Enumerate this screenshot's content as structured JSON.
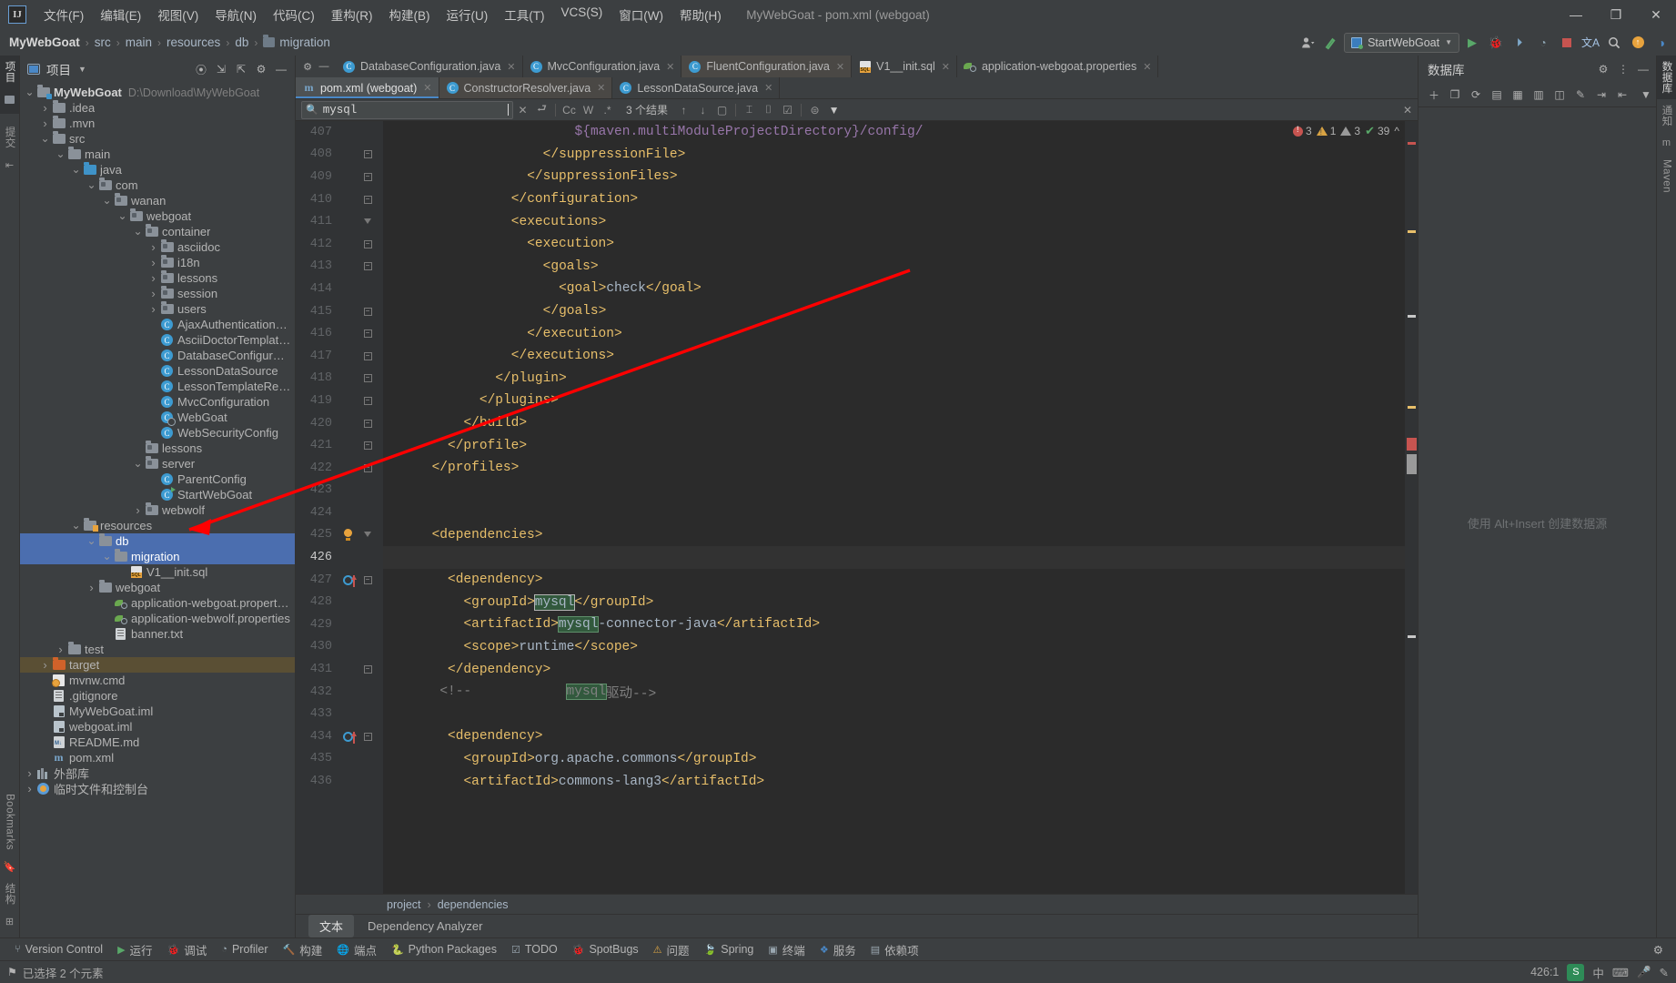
{
  "window": {
    "title": "MyWebGoat - pom.xml (webgoat)",
    "minimize": "—",
    "maximize": "❐",
    "close": "✕"
  },
  "menubar": {
    "logo": "IJ",
    "items": [
      {
        "label": "文件(F)"
      },
      {
        "label": "编辑(E)"
      },
      {
        "label": "视图(V)"
      },
      {
        "label": "导航(N)"
      },
      {
        "label": "代码(C)"
      },
      {
        "label": "重构(R)"
      },
      {
        "label": "构建(B)"
      },
      {
        "label": "运行(U)"
      },
      {
        "label": "工具(T)"
      },
      {
        "label": "VCS(S)"
      },
      {
        "label": "窗口(W)"
      },
      {
        "label": "帮助(H)"
      }
    ]
  },
  "navbar": {
    "crumbs": [
      "MyWebGoat",
      "src",
      "main",
      "resources",
      "db",
      "migration"
    ],
    "run_config": "StartWebGoat",
    "separator": "›"
  },
  "left_strip": {
    "project_label": "项目",
    "commit_label": "提交",
    "structure_label": "结构",
    "bookmarks_label": "Bookmarks"
  },
  "right_strip": {
    "database_label": "数据库",
    "notifications_label": "通知",
    "maven_label": "Maven"
  },
  "project_panel": {
    "title": "项目",
    "tree": [
      {
        "depth": 0,
        "arrow": "v",
        "icon": "module-folder",
        "label": "MyWebGoat",
        "sub": "D:\\Download\\MyWebGoat",
        "bold": true
      },
      {
        "depth": 1,
        "arrow": ">",
        "icon": "folder",
        "label": ".idea"
      },
      {
        "depth": 1,
        "arrow": ">",
        "icon": "folder",
        "label": ".mvn"
      },
      {
        "depth": 1,
        "arrow": "v",
        "icon": "folder",
        "label": "src"
      },
      {
        "depth": 2,
        "arrow": "v",
        "icon": "folder",
        "label": "main"
      },
      {
        "depth": 3,
        "arrow": "v",
        "icon": "source-folder",
        "label": "java"
      },
      {
        "depth": 4,
        "arrow": "v",
        "icon": "package",
        "label": "com"
      },
      {
        "depth": 5,
        "arrow": "v",
        "icon": "package",
        "label": "wanan"
      },
      {
        "depth": 6,
        "arrow": "v",
        "icon": "package",
        "label": "webgoat"
      },
      {
        "depth": 7,
        "arrow": "v",
        "icon": "package",
        "label": "container"
      },
      {
        "depth": 8,
        "arrow": ">",
        "icon": "package",
        "label": "asciidoc"
      },
      {
        "depth": 8,
        "arrow": ">",
        "icon": "package",
        "label": "i18n"
      },
      {
        "depth": 8,
        "arrow": ">",
        "icon": "package",
        "label": "lessons"
      },
      {
        "depth": 8,
        "arrow": ">",
        "icon": "package",
        "label": "session"
      },
      {
        "depth": 8,
        "arrow": ">",
        "icon": "package",
        "label": "users"
      },
      {
        "depth": 8,
        "arrow": "",
        "icon": "class",
        "label": "AjaxAuthenticationEntryPoint"
      },
      {
        "depth": 8,
        "arrow": "",
        "icon": "class",
        "label": "AsciiDoctorTemplateResolver"
      },
      {
        "depth": 8,
        "arrow": "",
        "icon": "class",
        "label": "DatabaseConfiguration"
      },
      {
        "depth": 8,
        "arrow": "",
        "icon": "class",
        "label": "LessonDataSource"
      },
      {
        "depth": 8,
        "arrow": "",
        "icon": "class",
        "label": "LessonTemplateResolver"
      },
      {
        "depth": 8,
        "arrow": "",
        "icon": "class",
        "label": "MvcConfiguration"
      },
      {
        "depth": 8,
        "arrow": "",
        "icon": "class-gear",
        "label": "WebGoat"
      },
      {
        "depth": 8,
        "arrow": "",
        "icon": "class",
        "label": "WebSecurityConfig"
      },
      {
        "depth": 7,
        "arrow": "",
        "icon": "package",
        "label": "lessons"
      },
      {
        "depth": 7,
        "arrow": "v",
        "icon": "package",
        "label": "server"
      },
      {
        "depth": 8,
        "arrow": "",
        "icon": "class",
        "label": "ParentConfig"
      },
      {
        "depth": 8,
        "arrow": "",
        "icon": "class-run",
        "label": "StartWebGoat"
      },
      {
        "depth": 7,
        "arrow": ">",
        "icon": "package",
        "label": "webwolf"
      },
      {
        "depth": 3,
        "arrow": "v",
        "icon": "resource-folder",
        "label": "resources"
      },
      {
        "depth": 4,
        "arrow": "v",
        "icon": "folder",
        "label": "db",
        "selected": true
      },
      {
        "depth": 5,
        "arrow": "v",
        "icon": "folder",
        "label": "migration",
        "selected": true
      },
      {
        "depth": 6,
        "arrow": "",
        "icon": "sql",
        "label": "V1__init.sql"
      },
      {
        "depth": 4,
        "arrow": ">",
        "icon": "folder",
        "label": "webgoat"
      },
      {
        "depth": 5,
        "arrow": "",
        "icon": "properties",
        "label": "application-webgoat.properties"
      },
      {
        "depth": 5,
        "arrow": "",
        "icon": "properties",
        "label": "application-webwolf.properties"
      },
      {
        "depth": 5,
        "arrow": "",
        "icon": "text",
        "label": "banner.txt"
      },
      {
        "depth": 2,
        "arrow": ">",
        "icon": "folder",
        "label": "test"
      },
      {
        "depth": 1,
        "arrow": ">",
        "icon": "folder-excluded",
        "label": "target",
        "highlighted": true
      },
      {
        "depth": 1,
        "arrow": "",
        "icon": "cmd",
        "label": "mvnw.cmd"
      },
      {
        "depth": 1,
        "arrow": "",
        "icon": "gitignore",
        "label": ".gitignore"
      },
      {
        "depth": 1,
        "arrow": "",
        "icon": "iml",
        "label": "MyWebGoat.iml"
      },
      {
        "depth": 1,
        "arrow": "",
        "icon": "iml",
        "label": "webgoat.iml"
      },
      {
        "depth": 1,
        "arrow": "",
        "icon": "markdown",
        "label": "README.md"
      },
      {
        "depth": 1,
        "arrow": "",
        "icon": "maven",
        "label": "pom.xml"
      },
      {
        "depth": 0,
        "arrow": ">",
        "icon": "library",
        "label": "外部库"
      },
      {
        "depth": 0,
        "arrow": ">",
        "icon": "scratch",
        "label": "临时文件和控制台"
      }
    ]
  },
  "editor": {
    "tabs_row1": [
      {
        "label": "DatabaseConfiguration.java",
        "icon": "class",
        "state": "normal"
      },
      {
        "label": "MvcConfiguration.java",
        "icon": "class",
        "state": "normal"
      },
      {
        "label": "FluentConfiguration.java",
        "icon": "class",
        "state": "modified"
      },
      {
        "label": "V1__init.sql",
        "icon": "sql",
        "state": "normal"
      },
      {
        "label": "application-webgoat.properties",
        "icon": "properties",
        "state": "normal"
      }
    ],
    "tabs_row2": [
      {
        "label": "pom.xml (webgoat)",
        "icon": "maven",
        "state": "active"
      },
      {
        "label": "ConstructorResolver.java",
        "icon": "class",
        "state": "modified"
      },
      {
        "label": "LessonDataSource.java",
        "icon": "class",
        "state": "normal"
      }
    ],
    "find": {
      "value": "mysql",
      "results": "3 个结果",
      "match_case": "Cc",
      "words": "W",
      "regex": ".*",
      "close": "✕"
    },
    "inspections": {
      "errors": "3",
      "warnings": "1",
      "weak_warnings": "3",
      "checks": "39"
    },
    "breadcrumbs": [
      "project",
      "dependencies"
    ],
    "bottom_tabs": [
      {
        "label": "文本",
        "active": true
      },
      {
        "label": "Dependency Analyzer",
        "active": false
      }
    ],
    "code_lines": [
      {
        "num": "407",
        "fold": "",
        "indent": 23,
        "tokens": [
          {
            "t": "${maven.multiModuleProjectDirectory}/config/",
            "c": "mvar"
          }
        ]
      },
      {
        "num": "408",
        "fold": "minus",
        "indent": 19,
        "tokens": [
          {
            "t": "</suppressionFile>",
            "c": "tag"
          }
        ]
      },
      {
        "num": "409",
        "fold": "minus",
        "indent": 17,
        "tokens": [
          {
            "t": "</suppressionFiles>",
            "c": "tag"
          }
        ]
      },
      {
        "num": "410",
        "fold": "minus",
        "indent": 15,
        "tokens": [
          {
            "t": "</configuration>",
            "c": "tag"
          }
        ]
      },
      {
        "num": "411",
        "fold": "arrow",
        "indent": 15,
        "tokens": [
          {
            "t": "<executions>",
            "c": "tag"
          }
        ]
      },
      {
        "num": "412",
        "fold": "minus",
        "indent": 17,
        "tokens": [
          {
            "t": "<execution>",
            "c": "tag"
          }
        ]
      },
      {
        "num": "413",
        "fold": "minus",
        "indent": 19,
        "tokens": [
          {
            "t": "<goals>",
            "c": "tag"
          }
        ]
      },
      {
        "num": "414",
        "fold": "",
        "indent": 21,
        "tokens": [
          {
            "t": "<goal>",
            "c": "tag"
          },
          {
            "t": "check",
            "c": "txtv"
          },
          {
            "t": "</goal>",
            "c": "tag"
          }
        ]
      },
      {
        "num": "415",
        "fold": "minus",
        "indent": 19,
        "tokens": [
          {
            "t": "</goals>",
            "c": "tag"
          }
        ]
      },
      {
        "num": "416",
        "fold": "minus",
        "indent": 17,
        "tokens": [
          {
            "t": "</execution>",
            "c": "tag"
          }
        ]
      },
      {
        "num": "417",
        "fold": "minus",
        "indent": 15,
        "tokens": [
          {
            "t": "</executions>",
            "c": "tag"
          }
        ]
      },
      {
        "num": "418",
        "fold": "minus",
        "indent": 13,
        "tokens": [
          {
            "t": "</plugin>",
            "c": "tag"
          }
        ]
      },
      {
        "num": "419",
        "fold": "minus",
        "indent": 11,
        "tokens": [
          {
            "t": "</plugins>",
            "c": "tag"
          }
        ]
      },
      {
        "num": "420",
        "fold": "minus",
        "indent": 9,
        "tokens": [
          {
            "t": "</build>",
            "c": "tag"
          }
        ]
      },
      {
        "num": "421",
        "fold": "minus",
        "indent": 7,
        "tokens": [
          {
            "t": "</profile>",
            "c": "tag"
          }
        ]
      },
      {
        "num": "422",
        "fold": "minus",
        "indent": 5,
        "tokens": [
          {
            "t": "</profiles>",
            "c": "tag"
          }
        ]
      },
      {
        "num": "423",
        "fold": "",
        "indent": 0,
        "tokens": []
      },
      {
        "num": "424",
        "fold": "",
        "indent": 0,
        "tokens": []
      },
      {
        "num": "425",
        "fold": "arrow",
        "ann": "bulb",
        "indent": 5,
        "tokens": [
          {
            "t": "<dependencies>",
            "c": "tag"
          }
        ]
      },
      {
        "num": "426",
        "fold": "",
        "indent": 0,
        "current": true,
        "tokens": []
      },
      {
        "num": "427",
        "fold": "minus",
        "ann": "override",
        "indent": 7,
        "tokens": [
          {
            "t": "<dependency>",
            "c": "tag"
          }
        ]
      },
      {
        "num": "428",
        "fold": "",
        "indent": 9,
        "tokens": [
          {
            "t": "<groupId>",
            "c": "tag"
          },
          {
            "t": "mysql",
            "c": "txtv",
            "hl": "cursor"
          },
          {
            "t": "</groupId>",
            "c": "tag"
          }
        ]
      },
      {
        "num": "429",
        "fold": "",
        "indent": 9,
        "tokens": [
          {
            "t": "<artifactId>",
            "c": "tag"
          },
          {
            "t": "mysql",
            "c": "txtv",
            "hl": "match"
          },
          {
            "t": "-connector-java",
            "c": "txtv"
          },
          {
            "t": "</artifactId>",
            "c": "tag"
          }
        ]
      },
      {
        "num": "430",
        "fold": "",
        "indent": 9,
        "tokens": [
          {
            "t": "<scope>",
            "c": "tag"
          },
          {
            "t": "runtime",
            "c": "txtv"
          },
          {
            "t": "</scope>",
            "c": "tag"
          }
        ]
      },
      {
        "num": "431",
        "fold": "minus",
        "indent": 7,
        "tokens": [
          {
            "t": "</dependency>",
            "c": "tag"
          }
        ]
      },
      {
        "num": "432",
        "fold": "",
        "indent": 6,
        "tokens": [
          {
            "t": "<!--            ",
            "c": "cmt"
          },
          {
            "t": "mysql",
            "c": "cmt",
            "hl": "match"
          },
          {
            "t": "驱动-->",
            "c": "cmt"
          }
        ]
      },
      {
        "num": "433",
        "fold": "",
        "indent": 0,
        "tokens": []
      },
      {
        "num": "434",
        "fold": "minus",
        "ann": "override",
        "indent": 7,
        "tokens": [
          {
            "t": "<dependency>",
            "c": "tag"
          }
        ]
      },
      {
        "num": "435",
        "fold": "",
        "indent": 9,
        "tokens": [
          {
            "t": "<groupId>",
            "c": "tag"
          },
          {
            "t": "org.apache.commons",
            "c": "txtv"
          },
          {
            "t": "</groupId>",
            "c": "tag"
          }
        ]
      },
      {
        "num": "436",
        "fold": "",
        "indent": 9,
        "tokens": [
          {
            "t": "<artifactId>",
            "c": "tag"
          },
          {
            "t": "commons-lang3",
            "c": "txtv"
          },
          {
            "t": "</artifactId>",
            "c": "tag"
          }
        ]
      }
    ]
  },
  "database_panel": {
    "title": "数据库",
    "empty_hint": "使用 Alt+Insert 创建数据源"
  },
  "bottom_toolwindows": [
    {
      "label": "Version Control",
      "icon": "branch"
    },
    {
      "label": "运行",
      "icon": "play"
    },
    {
      "label": "调试",
      "icon": "bug"
    },
    {
      "label": "Profiler",
      "icon": "gauge"
    },
    {
      "label": "构建",
      "icon": "hammer"
    },
    {
      "label": "端点",
      "icon": "globe"
    },
    {
      "label": "Python Packages",
      "icon": "python"
    },
    {
      "label": "TODO",
      "icon": "check"
    },
    {
      "label": "SpotBugs",
      "icon": "bug2"
    },
    {
      "label": "问题",
      "icon": "warning"
    },
    {
      "label": "Spring",
      "icon": "leaf"
    },
    {
      "label": "终端",
      "icon": "terminal"
    },
    {
      "label": "服务",
      "icon": "services"
    },
    {
      "label": "依赖项",
      "icon": "deps"
    }
  ],
  "statusbar": {
    "message": "已选择 2 个元素",
    "caret": "426:1",
    "ime_lang": "中",
    "badges": [
      "S",
      "中",
      "mic",
      "hand"
    ]
  }
}
